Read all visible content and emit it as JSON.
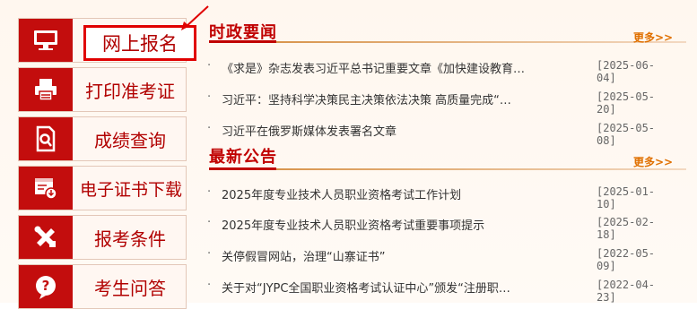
{
  "menu": {
    "items": [
      {
        "label": "网上报名",
        "icon": "monitor-icon"
      },
      {
        "label": "打印准考证",
        "icon": "printer-icon"
      },
      {
        "label": "成绩查询",
        "icon": "document-search-icon"
      },
      {
        "label": "电子证书下载",
        "icon": "certificate-download-icon"
      },
      {
        "label": "报考条件",
        "icon": "tools-icon"
      },
      {
        "label": "考生问答",
        "icon": "question-icon"
      }
    ]
  },
  "politics": {
    "title": "时政要闻",
    "more": "更多>>",
    "items": [
      {
        "title": "《求是》杂志发表习近平总书记重要文章《加快建设教育…",
        "date": "[2025-06-04]"
      },
      {
        "title": "习近平：坚持科学决策民主决策依法决策 高质量完成“…",
        "date": "[2025-05-20]"
      },
      {
        "title": "习近平在俄罗斯媒体发表署名文章",
        "date": "[2025-05-08]"
      }
    ]
  },
  "notices": {
    "title": "最新公告",
    "more": "更多>>",
    "items": [
      {
        "title": "2025年度专业技术人员职业资格考试工作计划",
        "date": "[2025-01-10]"
      },
      {
        "title": "2025年度专业技术人员职业资格考试重要事项提示",
        "date": "[2025-02-18]"
      },
      {
        "title": "关停假冒网站，治理“山寨证书”",
        "date": "[2022-05-09]"
      },
      {
        "title": "关于对“JYPC全国职业资格考试认证中心”颁发“注册职…",
        "date": "[2022-04-23]"
      }
    ]
  },
  "colors": {
    "accent": "#c30d0d",
    "highlight": "#e00000",
    "more": "#e07000"
  }
}
